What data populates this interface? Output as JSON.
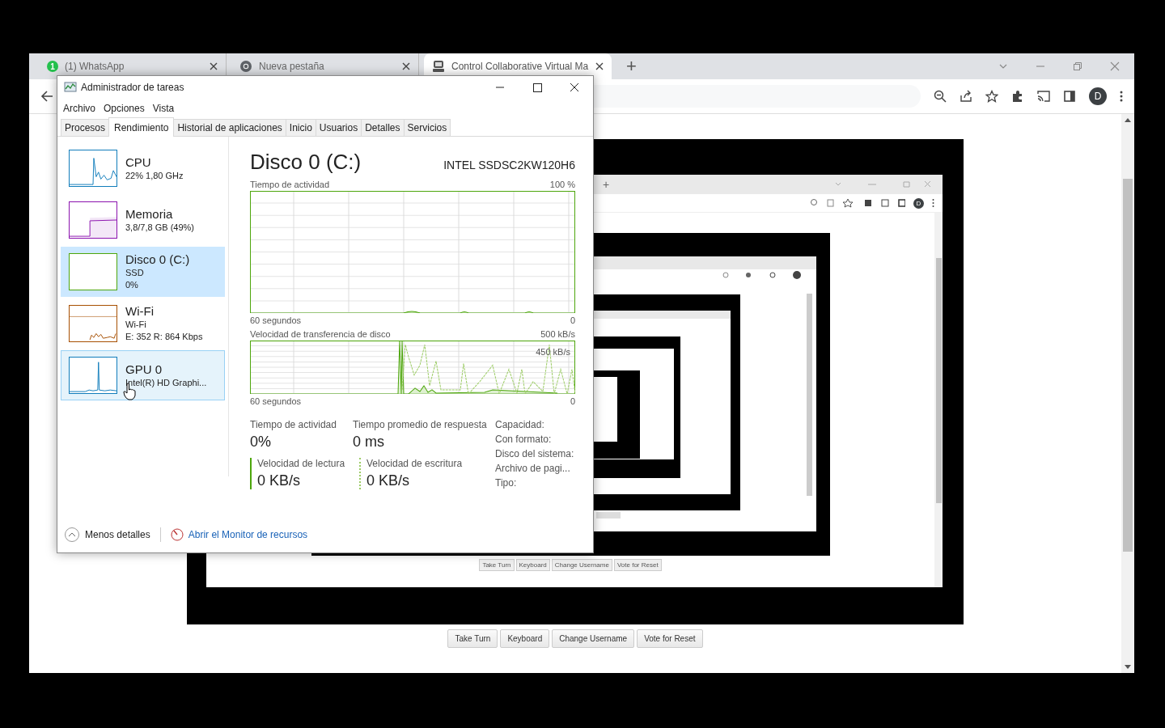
{
  "browser": {
    "tabs": [
      {
        "title": "(1) WhatsApp",
        "badge": "1",
        "kind": "whatsapp",
        "selected": false
      },
      {
        "title": "Nueva pestaña",
        "kind": "chrome",
        "selected": false
      },
      {
        "title": "Control Collaborative Virtual Ma",
        "kind": "vm",
        "selected": true
      }
    ],
    "new_tab": "+",
    "avatar": "D"
  },
  "remote_screen": {
    "new_tab": "+",
    "avatar": "D",
    "buttons": [
      "Take Turn",
      "Keyboard",
      "Change Username",
      "Vote for Reset"
    ]
  },
  "buttons": [
    "Take Turn",
    "Keyboard",
    "Change Username",
    "Vote for Reset"
  ],
  "task_manager": {
    "title": "Administrador de tareas",
    "menu": [
      "Archivo",
      "Opciones",
      "Vista"
    ],
    "tabs": [
      {
        "label": "Procesos",
        "selected": false
      },
      {
        "label": "Rendimiento",
        "selected": true
      },
      {
        "label": "Historial de aplicaciones",
        "selected": false
      },
      {
        "label": "Inicio",
        "selected": false
      },
      {
        "label": "Usuarios",
        "selected": false
      },
      {
        "label": "Detalles",
        "selected": false
      },
      {
        "label": "Servicios",
        "selected": false
      }
    ],
    "resources": [
      {
        "kind": "cpu",
        "name": "CPU",
        "lines": [
          "22% 1,80 GHz"
        ],
        "color": "#117dbb",
        "selected": false,
        "hovered": false
      },
      {
        "kind": "memory",
        "name": "Memoria",
        "lines": [
          "3,8/7,8 GB (49%)"
        ],
        "color": "#8b12ae",
        "selected": false,
        "hovered": false
      },
      {
        "kind": "disk",
        "name": "Disco 0 (C:)",
        "lines": [
          "SSD",
          "0%"
        ],
        "color": "#4da60c",
        "selected": true,
        "hovered": false
      },
      {
        "kind": "network",
        "name": "Wi-Fi",
        "lines": [
          "Wi-Fi",
          "E: 352 R: 864 Kbps"
        ],
        "color": "#a74f01",
        "selected": false,
        "hovered": false
      },
      {
        "kind": "gpu",
        "name": "GPU 0",
        "lines": [
          "Intel(R) HD Graphi..."
        ],
        "color": "#117dbb",
        "selected": false,
        "hovered": true
      }
    ],
    "detail": {
      "title": "Disco 0 (C:)",
      "model": "INTEL SSDSC2KW120H6",
      "graphs": [
        {
          "kind": "activity",
          "label": "Tiempo de actividad",
          "max": "100 %",
          "time": "60 segundos",
          "min": "0"
        },
        {
          "kind": "transfer",
          "label": "Velocidad de transferencia de disco",
          "max": "500 kB/s",
          "marker": "450 kB/s",
          "time": "60 segundos",
          "min": "0"
        }
      ],
      "stats": [
        {
          "kind": "plain",
          "label": "Tiempo de actividad",
          "value": "0%"
        },
        {
          "kind": "plain",
          "label": "Tiempo promedio de respuesta",
          "value": "0 ms"
        },
        {
          "kind": "read",
          "label": "Velocidad de lectura",
          "value": "0 KB/s"
        },
        {
          "kind": "write",
          "label": "Velocidad de escritura",
          "value": "0 KB/s"
        }
      ],
      "properties": [
        "Capacidad:",
        "Con formato:",
        "Disco del sistema:",
        "Archivo de pagi...",
        "Tipo:"
      ]
    },
    "footer": {
      "less": "Menos detalles",
      "link": "Abrir el Monitor de recursos"
    }
  }
}
